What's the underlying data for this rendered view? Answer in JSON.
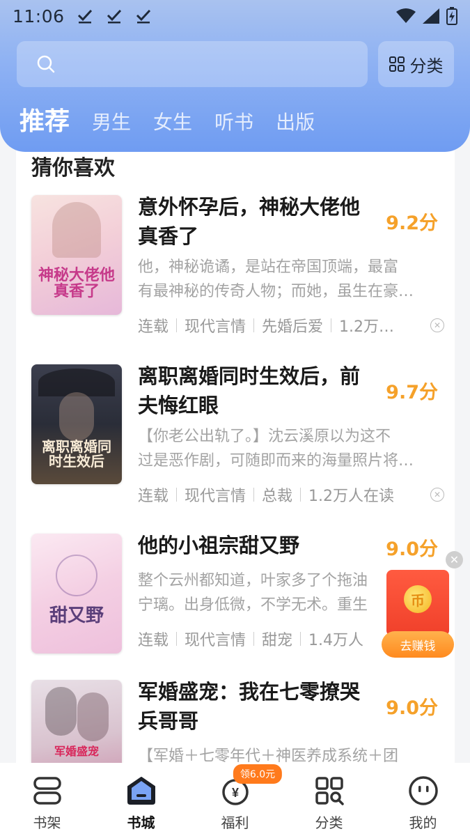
{
  "status_bar": {
    "time": "11:06"
  },
  "search": {
    "placeholder": ""
  },
  "category_button": {
    "label": "分类"
  },
  "tabs": [
    {
      "label": "推荐",
      "active": true
    },
    {
      "label": "男生"
    },
    {
      "label": "女生"
    },
    {
      "label": "听书"
    },
    {
      "label": "出版"
    }
  ],
  "section": {
    "title": "猜你喜欢"
  },
  "books": [
    {
      "cover_text": "神秘大佬他真香了",
      "title_line1": "意外怀孕后，神秘大佬他",
      "title_line2": "真香了",
      "score": "9.2分",
      "desc_line1": "他，神秘诡谲，是站在帝国顶端，最富",
      "desc_line2": "有最神秘的传奇人物；而她，虽生在豪…",
      "tags": [
        "连载",
        "现代言情",
        "先婚后爱",
        "1.2万…"
      ]
    },
    {
      "cover_text": "离职离婚同时生效后",
      "title_line1": "离职离婚同时生效后，前",
      "title_line2": "夫悔红眼",
      "score": "9.7分",
      "desc_line1": "【你老公出轨了。】沈云溪原以为这不",
      "desc_line2": "过是恶作剧，可随即而来的海量照片将…",
      "tags": [
        "连载",
        "现代言情",
        "总裁",
        "1.2万人在读"
      ]
    },
    {
      "cover_text": "甜又野",
      "title_line1": "他的小祖宗甜又野",
      "title_line2": "",
      "score": "9.0分",
      "desc_line1": "整个云州都知道，叶家多了个拖油",
      "desc_line2": "宁璃。出身低微，不学无术。重生",
      "tags": [
        "连载",
        "现代言情",
        "甜宠",
        "1.4万人"
      ]
    },
    {
      "cover_text": "军婚盛宠",
      "title_line1": "军婚盛宠：我在七零撩哭",
      "title_line2": "兵哥哥",
      "score": "9.0分",
      "desc_line1": "【军婚＋七零年代＋神医养成系统＋团",
      "desc_line2": "",
      "tags": []
    }
  ],
  "floating": {
    "earn_label": "去赚钱",
    "coin_symbol": "币"
  },
  "bottom_nav": [
    {
      "label": "书架",
      "icon": "bookshelf-icon"
    },
    {
      "label": "书城",
      "icon": "bookstore-icon",
      "active": true
    },
    {
      "label": "福利",
      "icon": "welfare-icon",
      "badge": "领6.0元"
    },
    {
      "label": "分类",
      "icon": "category-icon"
    },
    {
      "label": "我的",
      "icon": "profile-icon"
    }
  ],
  "colors": {
    "accent": "#6f9cf2",
    "score": "#f5a12a",
    "badge": "#ff7a1c",
    "redpacket": "#f0402a"
  }
}
